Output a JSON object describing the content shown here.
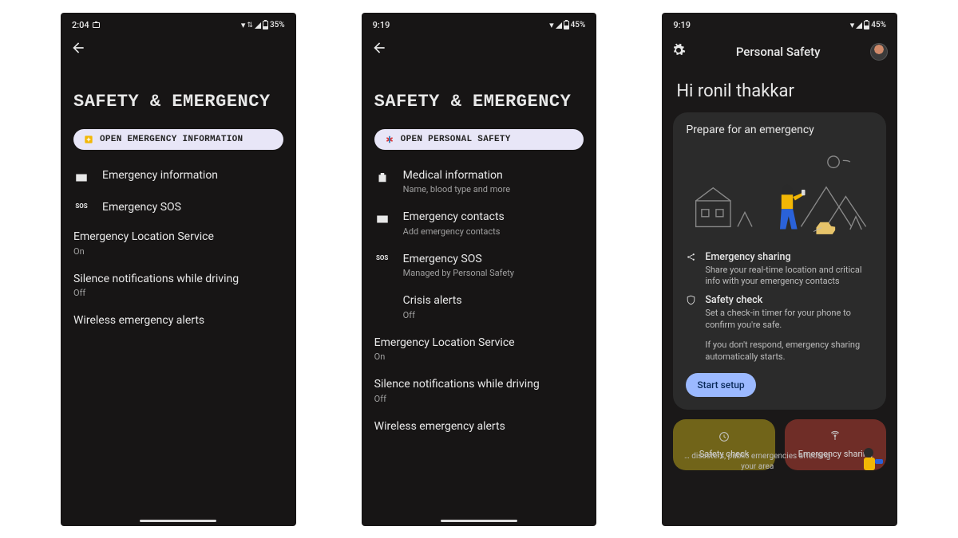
{
  "phone1": {
    "status": {
      "time": "2:04",
      "battery": "35%"
    },
    "title": "SAFETY & EMERGENCY",
    "chip": "OPEN EMERGENCY INFORMATION",
    "items": [
      {
        "icon": "id-card",
        "title": "Emergency information",
        "sub": ""
      },
      {
        "icon": "sos",
        "title": "Emergency SOS",
        "sub": ""
      }
    ],
    "plain": [
      {
        "title": "Emergency Location Service",
        "sub": "On"
      },
      {
        "title": "Silence notifications while driving",
        "sub": "Off"
      },
      {
        "title": "Wireless emergency alerts",
        "sub": ""
      }
    ]
  },
  "phone2": {
    "status": {
      "time": "9:19",
      "battery": "45%"
    },
    "title": "SAFETY & EMERGENCY",
    "chip": "OPEN PERSONAL SAFETY",
    "items": [
      {
        "icon": "med",
        "title": "Medical information",
        "sub": "Name, blood type and more"
      },
      {
        "icon": "id-card",
        "title": "Emergency contacts",
        "sub": "Add emergency contacts"
      },
      {
        "icon": "sos",
        "title": "Emergency SOS",
        "sub": "Managed by Personal Safety"
      },
      {
        "icon": "",
        "title": "Crisis alerts",
        "sub": "Off"
      }
    ],
    "plain": [
      {
        "title": "Emergency Location Service",
        "sub": "On"
      },
      {
        "title": "Silence notifications while driving",
        "sub": "Off"
      },
      {
        "title": "Wireless emergency alerts",
        "sub": ""
      }
    ]
  },
  "phone3": {
    "status": {
      "time": "9:19",
      "battery": "45%"
    },
    "title": "Personal Safety",
    "greeting": "Hi ronil thakkar",
    "card": {
      "header": "Prepare for an emergency",
      "feat1": {
        "title": "Emergency sharing",
        "sub": "Share your real-time location and critical info with your emergency contacts"
      },
      "feat2": {
        "title": "Safety check",
        "sub": "Set a check-in timer for your phone to confirm you're safe."
      },
      "note": "If you don't respond, emergency sharing automatically starts.",
      "cta": "Start setup"
    },
    "tiles": {
      "left": "Safety check",
      "right": "Emergency sharing",
      "under": "… disasters, public emergencies affecting your area"
    }
  }
}
